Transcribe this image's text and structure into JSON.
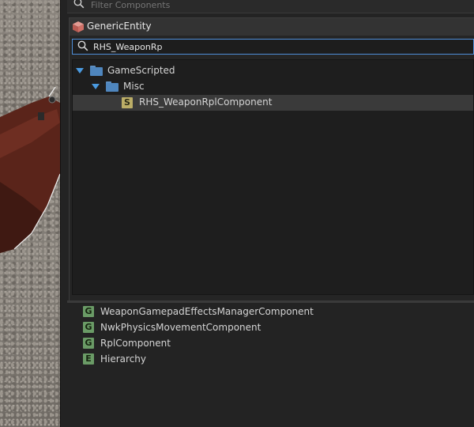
{
  "filter": {
    "placeholder": "Filter Components"
  },
  "popup": {
    "title": "GenericEntity",
    "search_value": "RHS_WeaponRp",
    "tree": {
      "root": {
        "label": "GameScripted"
      },
      "child": {
        "label": "Misc"
      },
      "leaf": {
        "badge": "S",
        "label": "RHS_WeaponRplComponent"
      }
    }
  },
  "components": [
    {
      "badge": "G",
      "label": "WeaponGamepadEffectsManagerComponent"
    },
    {
      "badge": "G",
      "label": "NwkPhysicsMovementComponent"
    },
    {
      "badge": "G",
      "label": "RplComponent"
    },
    {
      "badge": "E",
      "label": "Hierarchy"
    }
  ],
  "colors": {
    "accent": "#4e8fd9",
    "folder": "#4f86be",
    "script_badge": "#bcae67",
    "component_badge": "#6a9b66"
  }
}
